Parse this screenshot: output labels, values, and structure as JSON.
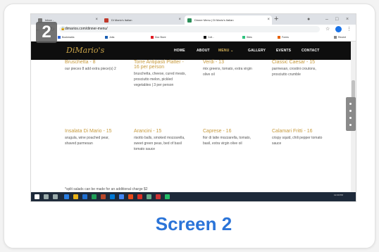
{
  "step_badge": "2",
  "browser": {
    "tabs": [
      {
        "title": "Inbox - "
      },
      {
        "title": "Di Mario's Italian"
      },
      {
        "title": "Dinner Menu | Di Mario's Italian"
      }
    ],
    "url": "dimarios.com/dinner-menu/"
  },
  "bookmarks": [
    "Bookmarks",
    "Jobs",
    "Doc Store",
    "Coll...",
    "Sites",
    "Forms",
    "Recent"
  ],
  "site": {
    "logo": "DiMario's",
    "nav": [
      "HOME",
      "ABOUT",
      "MENU ⌄",
      "GALLERY",
      "EVENTS",
      "CONTACT"
    ]
  },
  "menu_items": [
    {
      "name": "Bruschetta - 8",
      "desc": "our pieces 8 add extra piece(s) 2"
    },
    {
      "name": "Torre Antipasti Platter - 16 per person",
      "desc": "bruschetta, cheese, cured meats, prosciutto melon, pickled vegetables | 3 per person"
    },
    {
      "name": "Verdi - 13",
      "desc": "mix greens, tomato, extra virgin olive oil"
    },
    {
      "name": "Classic Caesar - 15",
      "desc": "parmesan, crostini croutons, prosciutto crumble"
    },
    {
      "name": "Insalata Di Mario - 15",
      "desc": "arugula, wine poached pear, shaved parmesan"
    },
    {
      "name": "Arancini - 15",
      "desc": "risotto balls, smoked mozzarella, sweet green peas, bed of basil tomato sauce"
    },
    {
      "name": "Caprese - 16",
      "desc": "fior di latte mozzarella, tomato, basil, extra virgin olive oil"
    },
    {
      "name": "Calamari Fritti - 16",
      "desc": "crispy squid, chili pepper tomato sauce"
    }
  ],
  "note": "*split salads can be made for an additional charge $2",
  "taskbar": {
    "time": "12:00 PM"
  },
  "caption": "Screen 2"
}
